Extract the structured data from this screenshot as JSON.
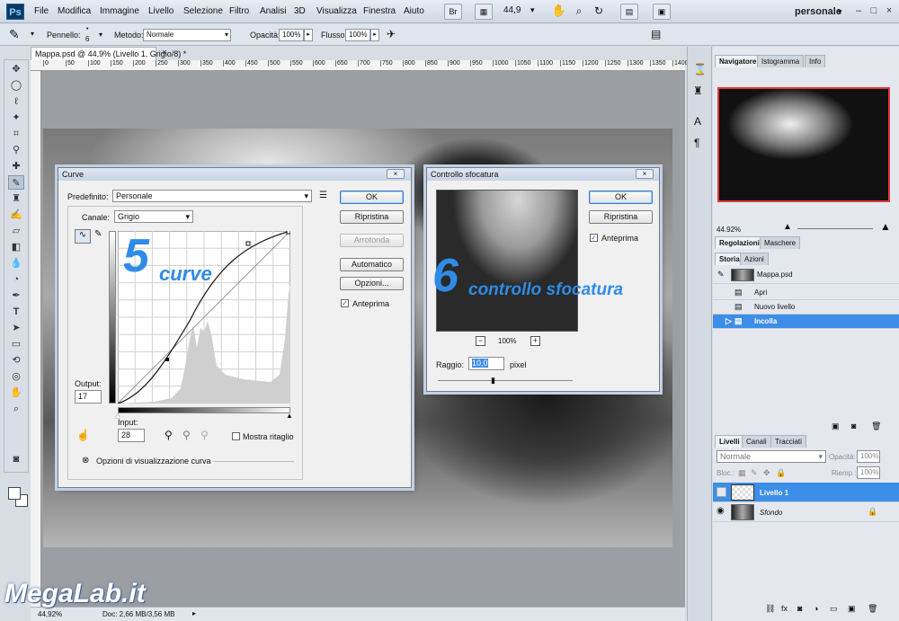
{
  "app": {
    "logo": "Ps"
  },
  "menu": [
    "File",
    "Modifica",
    "Immagine",
    "Livello",
    "Selezione",
    "Filtro",
    "Analisi",
    "3D",
    "Visualizza",
    "Finestra",
    "Aiuto"
  ],
  "menubar_controls": {
    "bridge": "Br",
    "zoom": "44,9",
    "workspace": "personale"
  },
  "options_bar": {
    "brush_label": "Pennello:",
    "brush_size": "6",
    "mode_label": "Metodo:",
    "mode_value": "Normale",
    "opacity_label": "Opacità:",
    "opacity_value": "100%",
    "flow_label": "Flusso:",
    "flow_value": "100%"
  },
  "document": {
    "tab_title": "Mappa.psd @ 44,9% (Livello 1, Grigio/8) *",
    "close": "×",
    "ruler_ticks": [
      "0",
      "50",
      "100",
      "150",
      "200",
      "250",
      "300",
      "350",
      "400",
      "450",
      "500",
      "550",
      "600",
      "650",
      "700",
      "750",
      "800",
      "850",
      "900",
      "950",
      "1000",
      "1050",
      "1100",
      "1150",
      "1200",
      "1250",
      "1300",
      "1350",
      "1400"
    ],
    "status_zoom": "44,92%",
    "status_doc": "Doc: 2,66 MB/3,56 MB"
  },
  "curve_dialog": {
    "title": "Curve",
    "preset_label": "Predefinito:",
    "preset_value": "Personale",
    "channel_label": "Canale:",
    "channel_value": "Grigio",
    "output_label": "Output:",
    "output_value": "17",
    "input_label": "Input:",
    "input_value": "28",
    "show_clipping": "Mostra ritaglio",
    "display_options": "Opzioni di visualizzazione curva",
    "buttons": {
      "ok": "OK",
      "reset": "Ripristina",
      "smooth": "Arrotonda",
      "auto": "Automatico",
      "options": "Opzioni...",
      "preview": "Anteprima"
    },
    "annotation_number": "5",
    "annotation_text": "curve"
  },
  "blur_dialog": {
    "title": "Controllo sfocatura",
    "zoom_value": "100%",
    "radius_label": "Raggio:",
    "radius_value": "10,0",
    "radius_unit": "pixel",
    "buttons": {
      "ok": "OK",
      "reset": "Ripristina",
      "preview": "Anteprima"
    },
    "annotation_number": "6",
    "annotation_text": "controllo sfocatura"
  },
  "navigator_panel": {
    "tabs": [
      "Navigatore",
      "Istogramma",
      "Info"
    ],
    "zoom_value": "44.92%"
  },
  "adjustments_panel": {
    "tabs": [
      "Regolazioni",
      "Maschere"
    ]
  },
  "history_panel": {
    "tabs": [
      "Storia",
      "Azioni"
    ],
    "snapshot": "Mappa.psd",
    "items": [
      "Apri",
      "Nuovo livello",
      "Incolla"
    ]
  },
  "layers_panel": {
    "tabs": [
      "Livelli",
      "Canali",
      "Tracciati"
    ],
    "blend_mode": "Normale",
    "opacity_label": "Opacità:",
    "opacity_value": "100%",
    "lock_label": "Bloc.:",
    "fill_label": "Riemp.:",
    "fill_value": "100%",
    "layers": [
      {
        "name": "Livello 1",
        "selected": true
      },
      {
        "name": "Sfondo",
        "selected": false
      }
    ]
  },
  "watermark": "MegaLab.it",
  "colors": {
    "accent": "#3c8ee8",
    "annotation": "#2f8be6"
  }
}
